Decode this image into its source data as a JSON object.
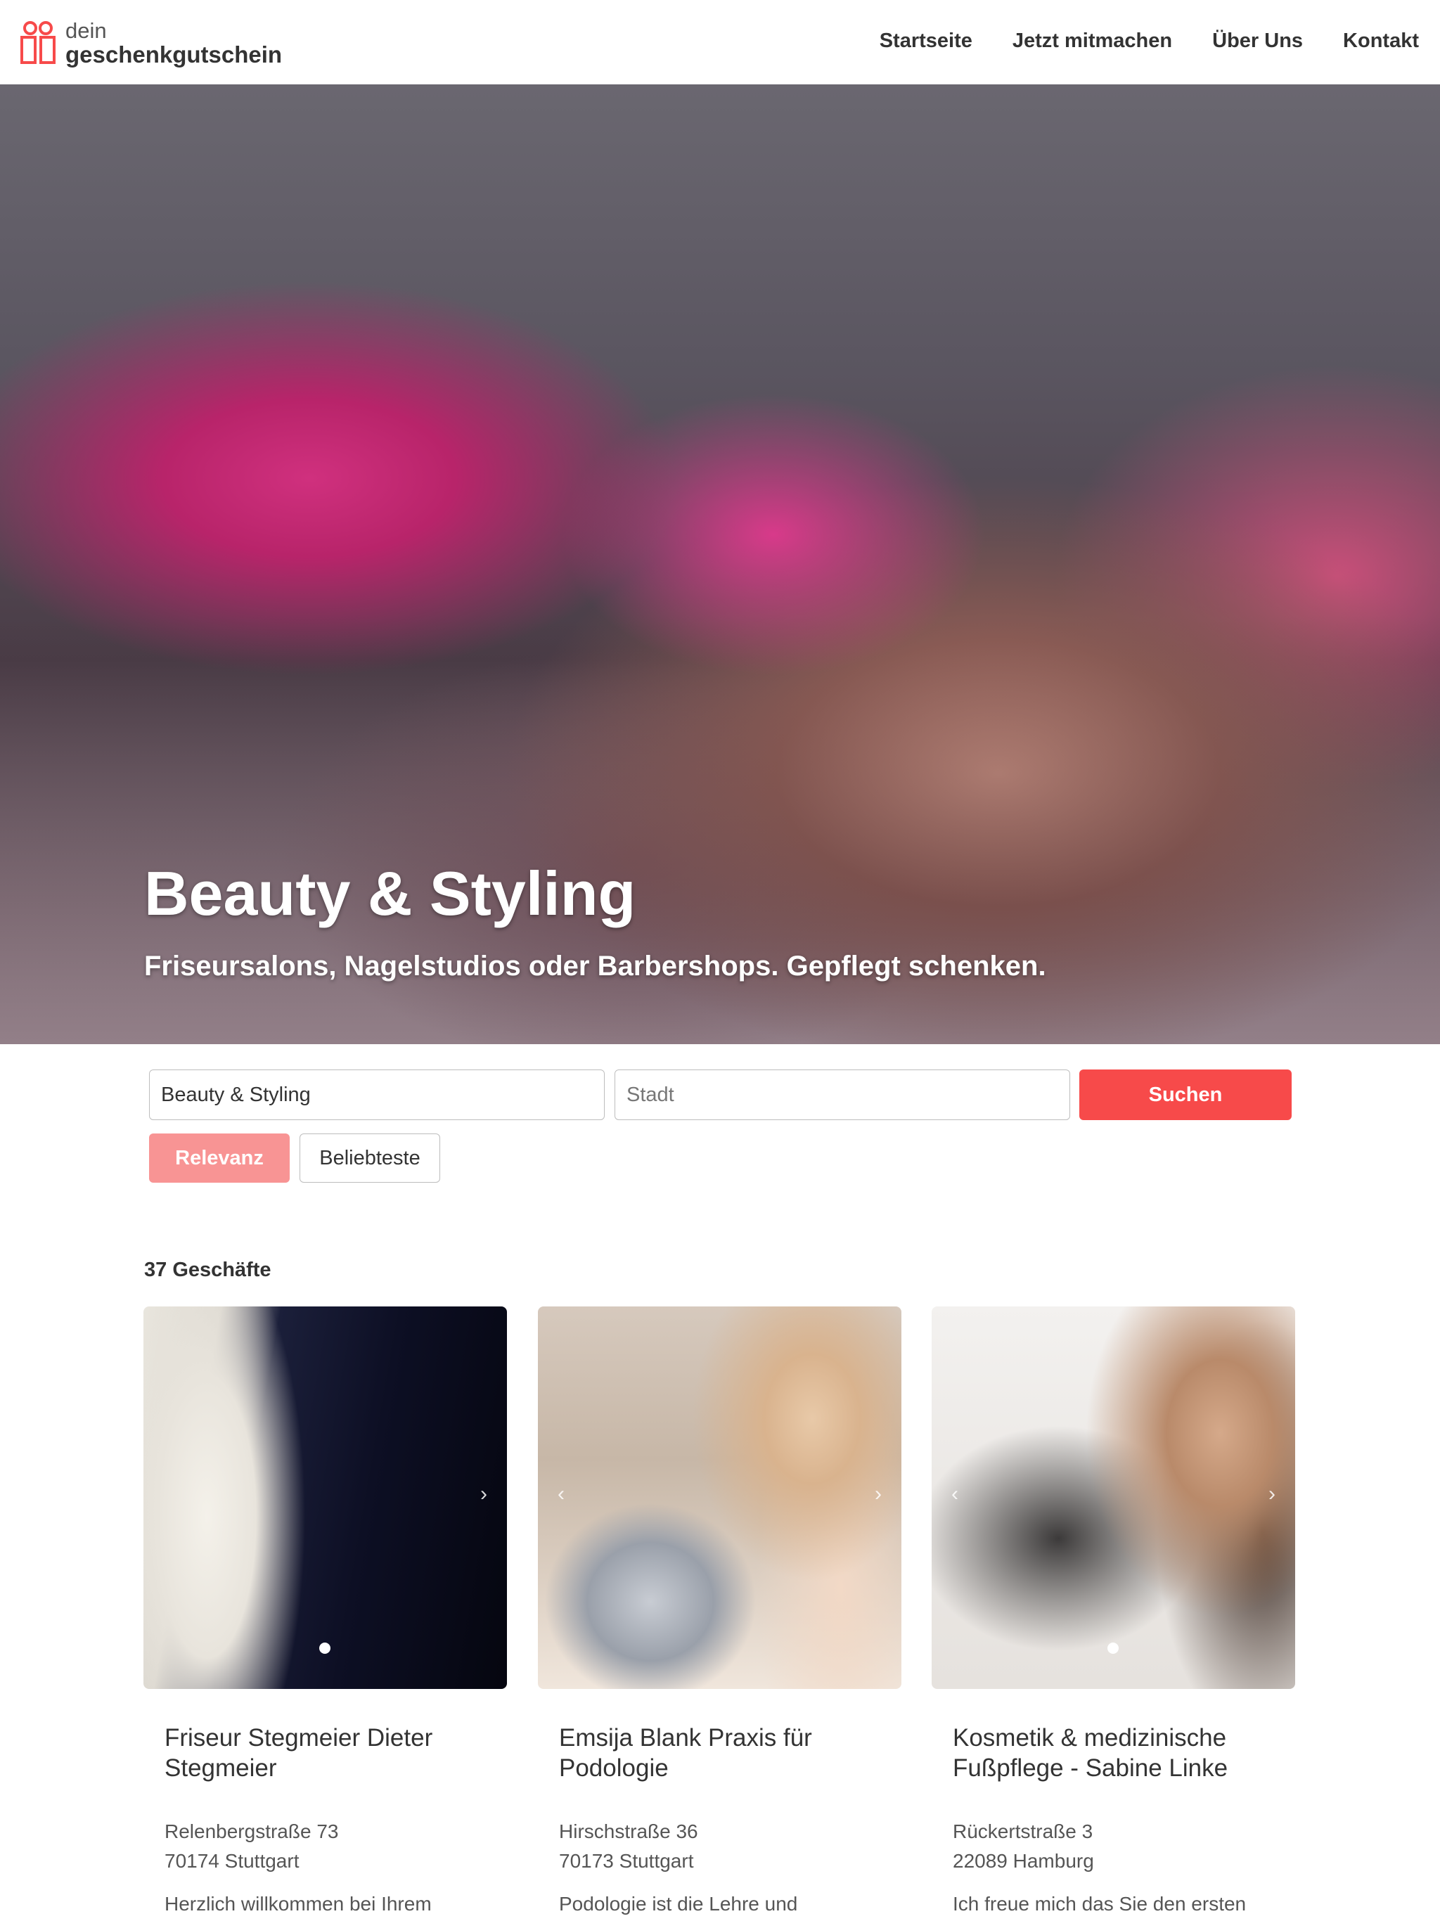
{
  "header": {
    "logo_top": "dein",
    "logo_bottom": "geschenkgutschein",
    "nav": [
      "Startseite",
      "Jetzt mitmachen",
      "Über Uns",
      "Kontakt"
    ]
  },
  "hero": {
    "title": "Beauty & Styling",
    "subtitle": "Friseursalons, Nagelstudios oder Barbershops. Gepflegt schenken."
  },
  "search": {
    "category_value": "Beauty & Styling",
    "city_placeholder": "Stadt",
    "button": "Suchen"
  },
  "sort": {
    "relevance": "Relevanz",
    "popular": "Beliebteste",
    "active": "Relevanz"
  },
  "results": {
    "count": "37 Geschäfte"
  },
  "cards": [
    {
      "title": "Friseur Stegmeier Dieter Stegmeier",
      "street": "Relenbergstraße 73",
      "city": "70174 Stuttgart",
      "description": "Herzlich willkommen bei Ihrem"
    },
    {
      "title": "Emsija Blank Praxis für Podologie",
      "street": "Hirschstraße 36",
      "city": "70173 Stuttgart",
      "description": "Podologie ist die Lehre und"
    },
    {
      "title": "Kosmetik & medizinische Fußpflege - Sabine Linke",
      "street": "Rückertstraße 3",
      "city": "22089 Hamburg",
      "description": "Ich freue mich das Sie den ersten"
    }
  ],
  "colors": {
    "accent": "#f74a4a",
    "accent_light": "#f89494",
    "text": "#333333"
  },
  "icons": {
    "logo": "gift-icon",
    "prev": "chevron-left-icon",
    "next": "chevron-right-icon"
  }
}
